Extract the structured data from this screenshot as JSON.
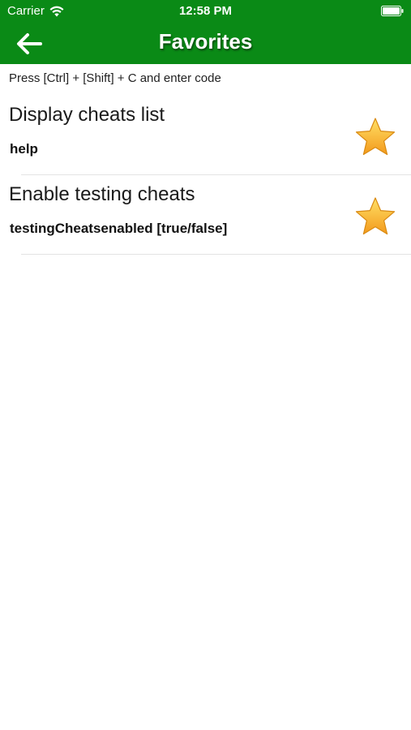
{
  "status_bar": {
    "carrier": "Carrier",
    "time": "12:58 PM",
    "wifi_icon": "wifi-icon",
    "battery_icon": "battery-icon"
  },
  "nav": {
    "title": "Favorites",
    "back_icon": "arrow-left-icon",
    "background_color": "#0a8a16"
  },
  "hint": "Press [Ctrl] + [Shift] + C and enter code",
  "favorites": [
    {
      "title": "Display cheats list",
      "code": "help",
      "icon": "star-icon"
    },
    {
      "title": "Enable testing cheats",
      "code": "testingCheatsenabled [true/false]",
      "icon": "star-icon"
    }
  ],
  "colors": {
    "header_green": "#0a8a16",
    "star_gold": "#f7b733",
    "separator": "#e3e3e3"
  }
}
